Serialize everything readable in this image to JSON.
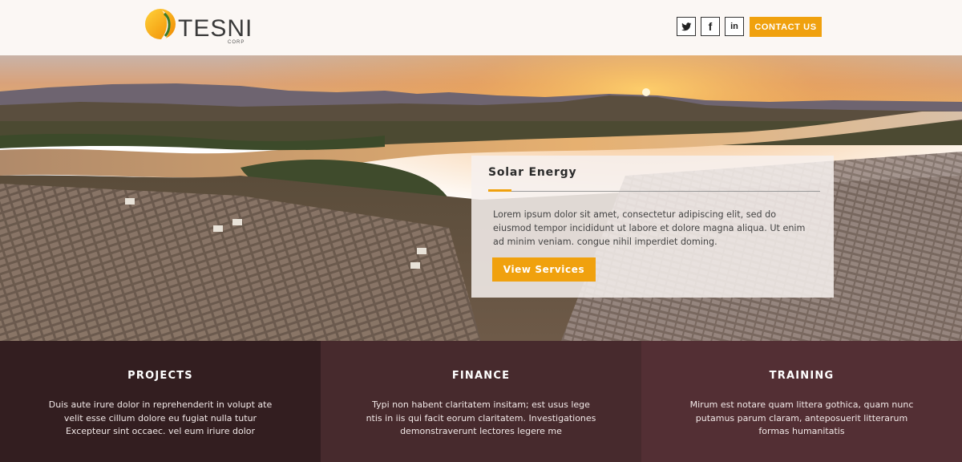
{
  "header": {
    "logo": {
      "name": "TESNI",
      "sub": "CORP"
    },
    "social": [
      {
        "icon": "twitter-icon"
      },
      {
        "icon": "facebook-icon",
        "glyph": "f"
      },
      {
        "icon": "linkedin-icon",
        "glyph": "in"
      }
    ],
    "contact_label": "CONTACT US"
  },
  "hero": {
    "card": {
      "title": "Solar Energy",
      "text": "Lorem ipsum dolor sit amet, consectetur adipiscing elit, sed do eiusmod tempor incididunt ut labore et dolore magna aliqua. Ut enim ad minim veniam. congue nihil imperdiet doming.",
      "button_label": "View Services"
    }
  },
  "features": [
    {
      "title": "PROJECTS",
      "text": "Duis aute irure dolor in reprehenderit in volupt ate velit esse cillum dolore eu fugiat nulla tutur Excepteur sint occaec. vel eum iriure dolor"
    },
    {
      "title": "FINANCE",
      "text": "Typi non habent claritatem insitam; est usus lege ntis in iis qui facit eorum claritatem. Investigationes demonstraverunt lectores legere me"
    },
    {
      "title": "TRAINING",
      "text": "Mirum est notare quam littera gothica, quam nunc putamus parum claram, anteposuerit litterarum formas humanitatis"
    }
  ],
  "colors": {
    "accent": "#f0a10e",
    "panel_projects": "#331e20",
    "panel_finance": "#472a2d",
    "panel_training": "#532f34"
  }
}
